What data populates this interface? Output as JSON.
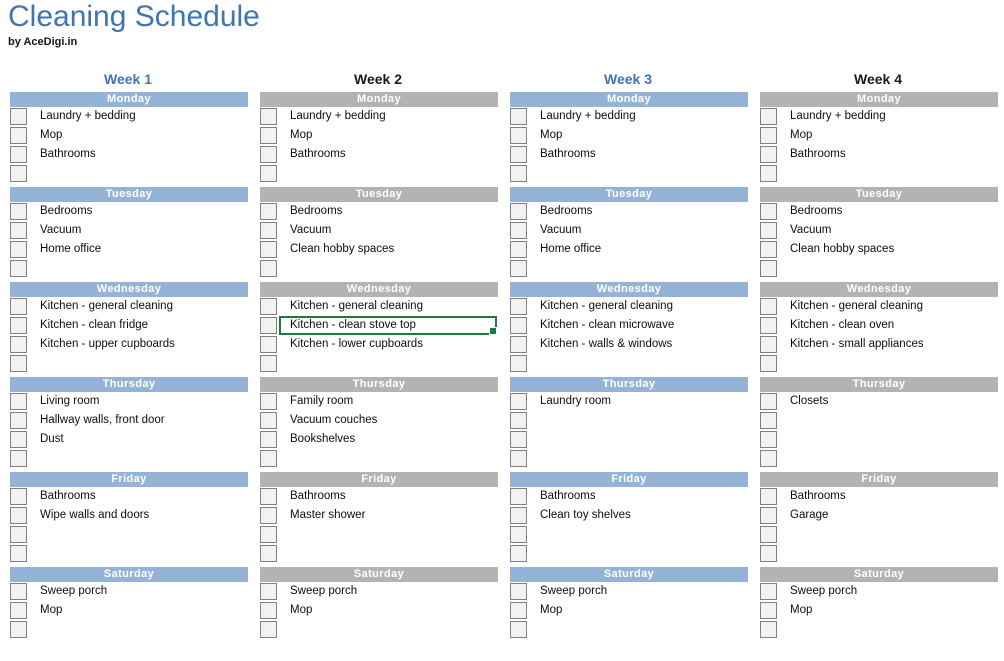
{
  "document": {
    "title": "Cleaning Schedule",
    "subtitle": "by AceDigi.in"
  },
  "colors": {
    "title_blue": "#3f74b5",
    "header_blue": "#95b3d7",
    "header_gray": "#b3b3b3",
    "selection_green": "#1c7a45",
    "checkbox_fill": "#f2f2f2",
    "checkbox_border": "#808080",
    "text": "#0d0d0d"
  },
  "weeks": [
    {
      "label": "Week 1",
      "accent": "blue",
      "days": [
        {
          "name": "Monday",
          "rows": 4,
          "tasks": [
            "Laundry + bedding",
            "Mop",
            "Bathrooms",
            ""
          ]
        },
        {
          "name": "Tuesday",
          "rows": 4,
          "tasks": [
            "Bedrooms",
            "Vacuum",
            "Home office",
            ""
          ]
        },
        {
          "name": "Wednesday",
          "rows": 4,
          "tasks": [
            "Kitchen - general cleaning",
            "Kitchen - clean fridge",
            "Kitchen - upper cupboards",
            ""
          ]
        },
        {
          "name": "Thursday",
          "rows": 4,
          "tasks": [
            "Living room",
            "Hallway walls, front door",
            "Dust",
            ""
          ]
        },
        {
          "name": "Friday",
          "rows": 4,
          "tasks": [
            "Bathrooms",
            "Wipe walls and doors",
            "",
            ""
          ]
        },
        {
          "name": "Saturday",
          "rows": 3,
          "tasks": [
            "Sweep porch",
            "Mop",
            ""
          ]
        }
      ]
    },
    {
      "label": "Week 2",
      "accent": "gray",
      "days": [
        {
          "name": "Monday",
          "rows": 4,
          "tasks": [
            "Laundry + bedding",
            "Mop",
            "Bathrooms",
            ""
          ]
        },
        {
          "name": "Tuesday",
          "rows": 4,
          "tasks": [
            "Bedrooms",
            "Vacuum",
            "Clean hobby spaces",
            ""
          ]
        },
        {
          "name": "Wednesday",
          "rows": 4,
          "tasks": [
            "Kitchen - general cleaning",
            "Kitchen - clean stove top",
            "Kitchen - lower cupboards",
            ""
          ],
          "selected_index": 1
        },
        {
          "name": "Thursday",
          "rows": 4,
          "tasks": [
            "Family room",
            "Vacuum couches",
            "Bookshelves",
            ""
          ]
        },
        {
          "name": "Friday",
          "rows": 4,
          "tasks": [
            "Bathrooms",
            "Master shower",
            "",
            ""
          ]
        },
        {
          "name": "Saturday",
          "rows": 3,
          "tasks": [
            "Sweep porch",
            "Mop",
            ""
          ]
        }
      ]
    },
    {
      "label": "Week 3",
      "accent": "blue",
      "days": [
        {
          "name": "Monday",
          "rows": 4,
          "tasks": [
            "Laundry + bedding",
            "Mop",
            "Bathrooms",
            ""
          ]
        },
        {
          "name": "Tuesday",
          "rows": 4,
          "tasks": [
            "Bedrooms",
            "Vacuum",
            "Home office",
            ""
          ]
        },
        {
          "name": "Wednesday",
          "rows": 4,
          "tasks": [
            "Kitchen - general cleaning",
            "Kitchen - clean microwave",
            "Kitchen - walls & windows",
            ""
          ]
        },
        {
          "name": "Thursday",
          "rows": 4,
          "tasks": [
            "Laundry room",
            "",
            "",
            ""
          ]
        },
        {
          "name": "Friday",
          "rows": 4,
          "tasks": [
            "Bathrooms",
            "Clean toy shelves",
            "",
            ""
          ]
        },
        {
          "name": "Saturday",
          "rows": 3,
          "tasks": [
            "Sweep porch",
            "Mop",
            ""
          ]
        }
      ]
    },
    {
      "label": "Week 4",
      "accent": "gray",
      "days": [
        {
          "name": "Monday",
          "rows": 4,
          "tasks": [
            "Laundry + bedding",
            "Mop",
            "Bathrooms",
            ""
          ]
        },
        {
          "name": "Tuesday",
          "rows": 4,
          "tasks": [
            "Bedrooms",
            "Vacuum",
            "Clean hobby spaces",
            ""
          ]
        },
        {
          "name": "Wednesday",
          "rows": 4,
          "tasks": [
            "Kitchen - general cleaning",
            "Kitchen - clean oven",
            "Kitchen - small appliances",
            ""
          ]
        },
        {
          "name": "Thursday",
          "rows": 4,
          "tasks": [
            "Closets",
            "",
            "",
            ""
          ]
        },
        {
          "name": "Friday",
          "rows": 4,
          "tasks": [
            "Bathrooms",
            "Garage",
            "",
            ""
          ]
        },
        {
          "name": "Saturday",
          "rows": 3,
          "tasks": [
            "Sweep porch",
            "Mop",
            ""
          ]
        }
      ]
    }
  ]
}
